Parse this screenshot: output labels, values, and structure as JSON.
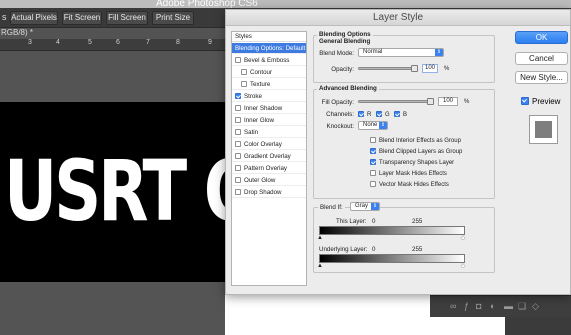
{
  "photoshop": {
    "app_title": "Adobe Photoshop CS6",
    "options_lead": "s",
    "options_buttons": [
      "Actual Pixels",
      "Fit Screen",
      "Fill Screen",
      "Print Size"
    ],
    "doc_tab": "RGB/8) *",
    "ruler_ticks": [
      "3",
      "4",
      "5",
      "6",
      "7",
      "8",
      "9"
    ],
    "canvas_text": "USRT O"
  },
  "dialog": {
    "title": "Layer Style",
    "styles": {
      "header": "Styles",
      "selected": "Blending Options: Default",
      "items": [
        {
          "label": "Bevel & Emboss",
          "checked": false
        },
        {
          "label": "Contour",
          "checked": false
        },
        {
          "label": "Texture",
          "checked": false
        },
        {
          "label": "Stroke",
          "checked": true
        },
        {
          "label": "Inner Shadow",
          "checked": false
        },
        {
          "label": "Inner Glow",
          "checked": false
        },
        {
          "label": "Satin",
          "checked": false
        },
        {
          "label": "Color Overlay",
          "checked": false
        },
        {
          "label": "Gradient Overlay",
          "checked": false
        },
        {
          "label": "Pattern Overlay",
          "checked": false
        },
        {
          "label": "Outer Glow",
          "checked": false
        },
        {
          "label": "Drop Shadow",
          "checked": false
        }
      ]
    },
    "blending": {
      "title": "Blending Options",
      "general_title": "General Blending",
      "blend_mode_label": "Blend Mode:",
      "blend_mode_value": "Normal",
      "opacity_label": "Opacity:",
      "opacity_value": "100",
      "opacity_unit": "%",
      "advanced_title": "Advanced Blending",
      "fill_opacity_label": "Fill Opacity:",
      "fill_opacity_value": "100",
      "fill_opacity_unit": "%",
      "channels_label": "Channels:",
      "channel_r": "R",
      "channel_g": "G",
      "channel_b": "B",
      "knockout_label": "Knockout:",
      "knockout_value": "None",
      "options": [
        {
          "label": "Blend Interior Effects as Group",
          "checked": false
        },
        {
          "label": "Blend Clipped Layers as Group",
          "checked": true
        },
        {
          "label": "Transparency Shapes Layer",
          "checked": true
        },
        {
          "label": "Layer Mask Hides Effects",
          "checked": false
        },
        {
          "label": "Vector Mask Hides Effects",
          "checked": false
        }
      ],
      "blend_if_label": "Blend If:",
      "blend_if_value": "Gray",
      "this_layer_label": "This Layer:",
      "this_layer_min": "0",
      "this_layer_max": "255",
      "underlying_label": "Underlying Layer:",
      "underlying_min": "0",
      "underlying_max": "255"
    },
    "buttons": {
      "ok": "OK",
      "cancel": "Cancel",
      "new_style": "New Style...",
      "preview_label": "Preview",
      "preview_checked": true
    }
  }
}
